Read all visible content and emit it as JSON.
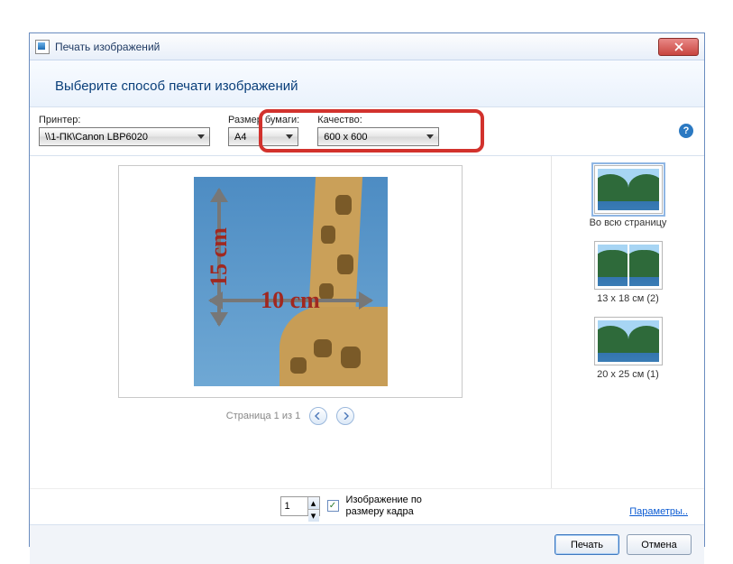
{
  "title": "Печать изображений",
  "header": "Выберите способ печати изображений",
  "toolbar": {
    "printer_label": "Принтер:",
    "printer_value": "\\\\1-ПК\\Canon LBP6020",
    "paper_label": "Размер бумаги:",
    "paper_value": "A4",
    "quality_label": "Качество:",
    "quality_value": "600 x 600"
  },
  "preview": {
    "dim_v": "15 cm",
    "dim_h": "10 cm",
    "page_status": "Страница 1 из 1"
  },
  "layouts": [
    {
      "label": "Во всю страницу"
    },
    {
      "label": "13 x 18 см (2)"
    },
    {
      "label": "20 x 25 см (1)"
    }
  ],
  "bottom": {
    "copies": "1",
    "fit_label": "Изображение по размеру кадра",
    "params_link": "Параметры.."
  },
  "footer": {
    "print": "Печать",
    "cancel": "Отмена"
  }
}
